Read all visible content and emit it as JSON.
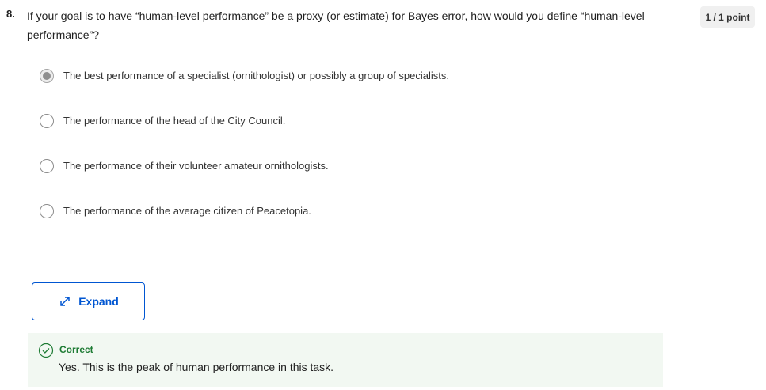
{
  "question": {
    "number": "8.",
    "text": "If your goal is to have “human-level performance” be a proxy (or estimate) for Bayes error, how would you define “human-level performance”?",
    "points": "1 / 1 point"
  },
  "options": [
    {
      "label": "The best performance of a specialist (ornithologist) or possibly a group of specialists.",
      "selected": true
    },
    {
      "label": "The performance of the head of the City Council.",
      "selected": false
    },
    {
      "label": "The performance of their volunteer amateur ornithologists.",
      "selected": false
    },
    {
      "label": "The performance of the average citizen of Peacetopia.",
      "selected": false
    }
  ],
  "expand_button": {
    "label": "Expand",
    "icon": "expand-arrows-icon"
  },
  "feedback": {
    "status": "Correct",
    "text": "Yes. This is the peak of human performance in this task.",
    "icon": "check-circle-icon"
  },
  "colors": {
    "accent": "#0056d2",
    "correct": "#1e7b34",
    "feedback_bg": "#f2f8f2",
    "badge_bg": "#f0f0f0"
  }
}
